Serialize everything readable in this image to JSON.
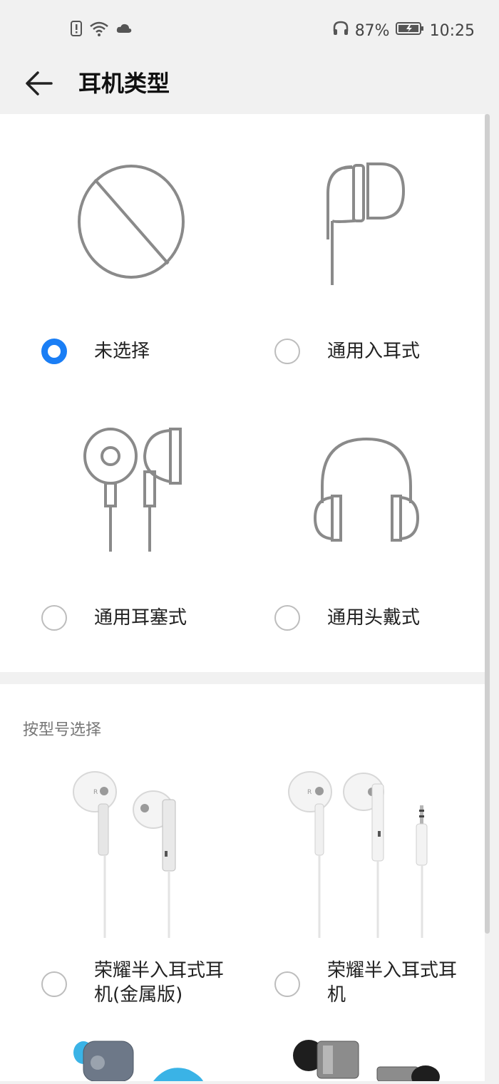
{
  "status_bar": {
    "battery": "87%",
    "time": "10:25",
    "icons": [
      "sim-alert-icon",
      "wifi-icon",
      "cloud-icon",
      "headphone-icon",
      "battery-icon"
    ]
  },
  "header": {
    "title": "耳机类型"
  },
  "types": [
    {
      "label": "未选择",
      "selected": true,
      "icon": "none-icon"
    },
    {
      "label": "通用入耳式",
      "selected": false,
      "icon": "in-ear-icon"
    },
    {
      "label": "通用耳塞式",
      "selected": false,
      "icon": "earbud-icon"
    },
    {
      "label": "通用头戴式",
      "selected": false,
      "icon": "over-ear-icon"
    }
  ],
  "models_section": {
    "label": "按型号选择"
  },
  "models": [
    {
      "label": "荣耀半入耳式耳\n机(金属版)",
      "selected": false
    },
    {
      "label": "荣耀半入耳式耳\n机",
      "selected": false
    }
  ],
  "colors": {
    "accent": "#1a7ef5",
    "icon_gray": "#8a8a8a"
  }
}
